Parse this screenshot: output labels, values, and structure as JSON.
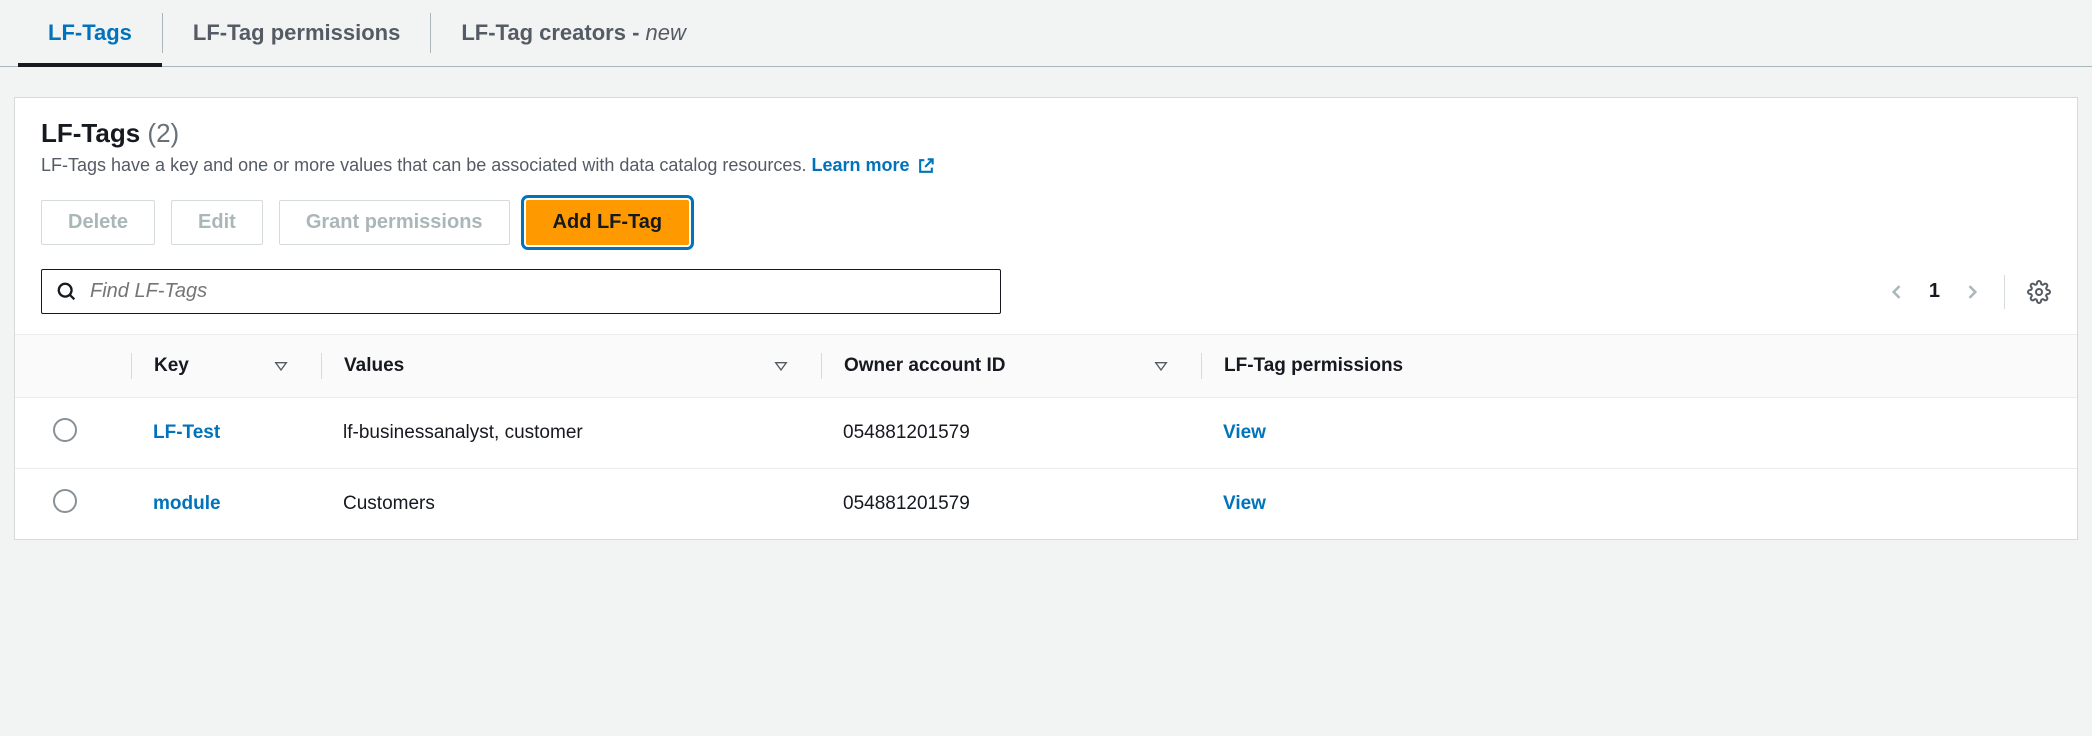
{
  "tabs": {
    "lfTags": "LF-Tags",
    "lfTagPermissions": "LF-Tag permissions",
    "lfTagCreatorsBase": "LF-Tag creators - ",
    "lfTagCreatorsNew": "new"
  },
  "header": {
    "title": "LF-Tags",
    "count": "(2)",
    "subtitle": "LF-Tags have a key and one or more values that can be associated with data catalog resources.",
    "learnMore": "Learn more"
  },
  "buttons": {
    "delete": "Delete",
    "edit": "Edit",
    "grant": "Grant permissions",
    "add": "Add LF-Tag"
  },
  "search": {
    "placeholder": "Find LF-Tags"
  },
  "pager": {
    "page": "1"
  },
  "columns": {
    "key": "Key",
    "values": "Values",
    "owner": "Owner account ID",
    "perms": "LF-Tag permissions"
  },
  "rows": [
    {
      "key": "LF-Test",
      "values": "lf-businessanalyst, customer",
      "owner": "054881201579",
      "perms": "View"
    },
    {
      "key": "module",
      "values": "Customers",
      "owner": "054881201579",
      "perms": "View"
    }
  ]
}
